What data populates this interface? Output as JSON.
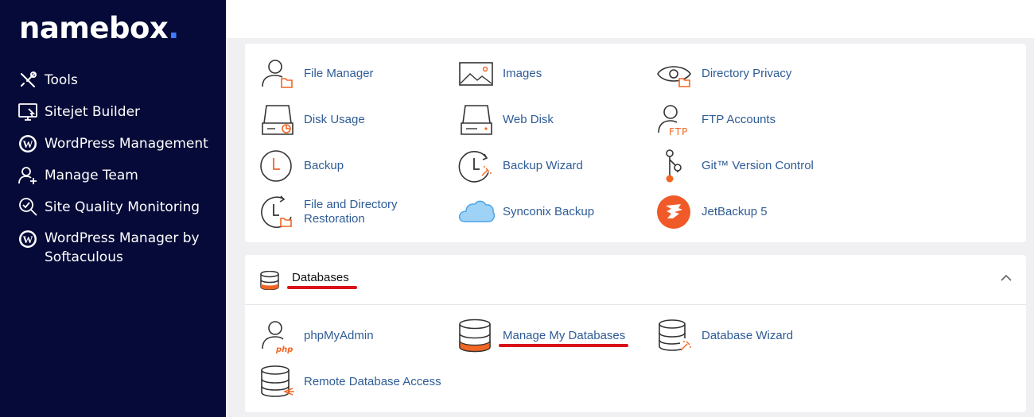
{
  "logo": {
    "text": "namebox",
    "dot": "."
  },
  "sidebar": {
    "items": [
      {
        "label": "Tools",
        "icon": "tools-icon"
      },
      {
        "label": "Sitejet Builder",
        "icon": "sitejet-icon"
      },
      {
        "label": "WordPress Management",
        "icon": "wordpress-icon"
      },
      {
        "label": "Manage Team",
        "icon": "manage-team-icon"
      },
      {
        "label": "Site Quality Monitoring",
        "icon": "site-quality-icon"
      },
      {
        "label": "WordPress Manager by Softaculous",
        "icon": "wordpress-icon"
      }
    ]
  },
  "files": {
    "tools": [
      {
        "label": "File Manager",
        "icon": "file-manager-icon"
      },
      {
        "label": "Images",
        "icon": "images-icon"
      },
      {
        "label": "Directory Privacy",
        "icon": "directory-privacy-icon"
      },
      {
        "label": "Disk Usage",
        "icon": "disk-usage-icon"
      },
      {
        "label": "Web Disk",
        "icon": "web-disk-icon"
      },
      {
        "label": "FTP Accounts",
        "icon": "ftp-accounts-icon"
      },
      {
        "label": "Backup",
        "icon": "backup-icon"
      },
      {
        "label": "Backup Wizard",
        "icon": "backup-wizard-icon"
      },
      {
        "label": "Git™ Version Control",
        "icon": "git-icon"
      },
      {
        "label": "File and Directory Restoration",
        "icon": "restoration-icon"
      },
      {
        "label": "Synconix Backup",
        "icon": "cloud-icon"
      },
      {
        "label": "JetBackup 5",
        "icon": "jetbackup-icon"
      }
    ]
  },
  "databases": {
    "title": "Databases",
    "tools": [
      {
        "label": "phpMyAdmin",
        "icon": "phpmyadmin-icon"
      },
      {
        "label": "Manage My Databases",
        "icon": "database-icon"
      },
      {
        "label": "Database Wizard",
        "icon": "database-wizard-icon"
      },
      {
        "label": "Remote Database Access",
        "icon": "remote-database-icon"
      }
    ]
  },
  "colors": {
    "sidebar": "#060a38",
    "link": "#2f5c96",
    "accent": "#f26522",
    "annotation": "#d9121a"
  }
}
